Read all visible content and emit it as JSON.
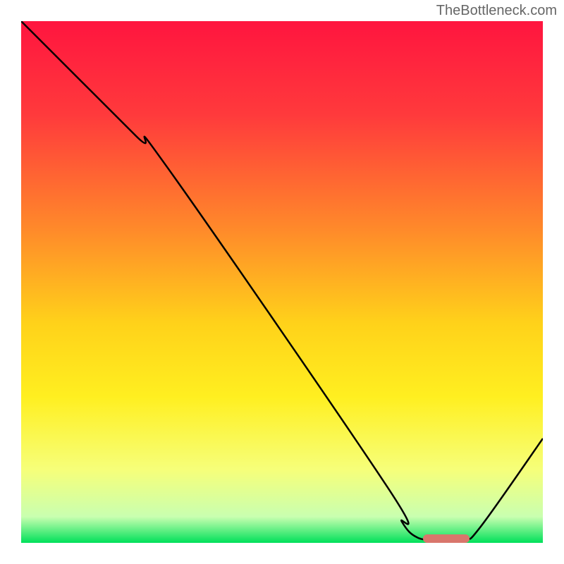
{
  "watermark": "TheBottleneck.com",
  "chart_data": {
    "type": "line",
    "title": "",
    "xlabel": "",
    "ylabel": "",
    "xlim": [
      0,
      100
    ],
    "ylim": [
      0,
      100
    ],
    "gradient_stops": [
      {
        "offset": 0,
        "color": "#ff153f"
      },
      {
        "offset": 18,
        "color": "#ff3a3c"
      },
      {
        "offset": 40,
        "color": "#ff8a2a"
      },
      {
        "offset": 58,
        "color": "#ffd21a"
      },
      {
        "offset": 72,
        "color": "#ffef20"
      },
      {
        "offset": 86,
        "color": "#f6ff7a"
      },
      {
        "offset": 95,
        "color": "#c9ffb0"
      },
      {
        "offset": 100,
        "color": "#00e05a"
      }
    ],
    "curve": [
      {
        "x": 0,
        "y": 100
      },
      {
        "x": 22,
        "y": 78
      },
      {
        "x": 28,
        "y": 72
      },
      {
        "x": 70,
        "y": 11
      },
      {
        "x": 73,
        "y": 4
      },
      {
        "x": 76,
        "y": 1.0
      },
      {
        "x": 80,
        "y": 0.6
      },
      {
        "x": 85,
        "y": 0.8
      },
      {
        "x": 88,
        "y": 3
      },
      {
        "x": 100,
        "y": 20
      }
    ],
    "highlight_range": {
      "start": 77,
      "end": 86
    },
    "marker_color": "#d9766c"
  }
}
